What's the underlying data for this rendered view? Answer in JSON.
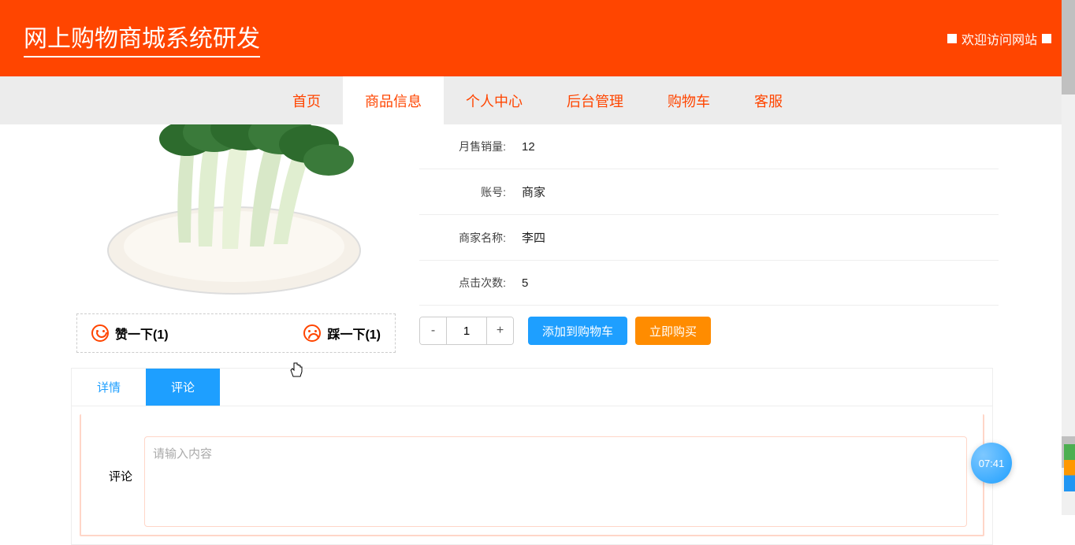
{
  "header": {
    "site_title": "网上购物商城系统研发",
    "welcome": "欢迎访问网站"
  },
  "nav": {
    "items": [
      "首页",
      "商品信息",
      "个人中心",
      "后台管理",
      "购物车",
      "客服"
    ],
    "active_index": 1
  },
  "product": {
    "info": [
      {
        "label": "月售销量:",
        "value": "12"
      },
      {
        "label": "账号:",
        "value": "商家"
      },
      {
        "label": "商家名称:",
        "value": "李四"
      },
      {
        "label": "点击次数:",
        "value": "5"
      }
    ],
    "vote": {
      "up_label": "赞一下(1)",
      "down_label": "踩一下(1)"
    },
    "qty": {
      "minus": "-",
      "value": "1",
      "plus": "+"
    },
    "buttons": {
      "add_cart": "添加到购物车",
      "buy_now": "立即购买"
    }
  },
  "tabs": {
    "detail": "详情",
    "comment": "评论"
  },
  "form": {
    "label": "评论",
    "placeholder": "请输入内容"
  },
  "fab": {
    "time": "07:41"
  }
}
